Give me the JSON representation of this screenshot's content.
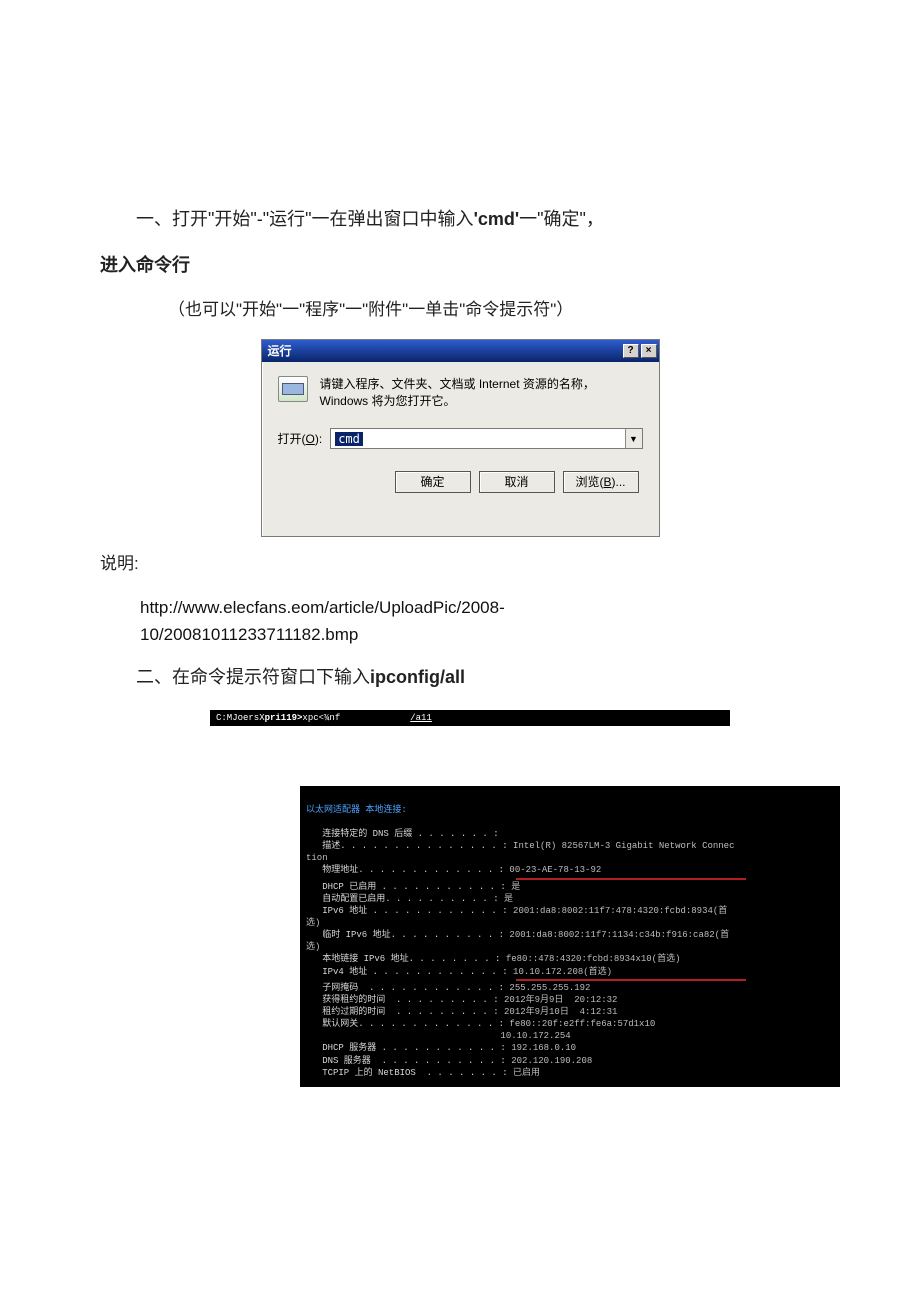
{
  "doc": {
    "p1_prefix": "一、打开\"开始\"-\"运行\"一在弹出窗口中输入",
    "p1_bold1": "'cmd'",
    "p1_suffix": "一\"确定\"，",
    "p2": "进入命令行",
    "p3": "（也可以\"开始\"一\"程序\"一\"附件\"一单击\"命令提示符\"）",
    "note_label": "说明:",
    "url_line1": "http://www.elecfans.eom/article/UploadPic/2008-",
    "url_line2": "10/20081011233711182.bmp",
    "p4_prefix": "二、在命令提示符窗口下输入",
    "p4_bold": "ipconfig/all"
  },
  "run_dialog": {
    "title": "运行",
    "help_btn": "?",
    "close_btn": "×",
    "message": "请键入程序、文件夹、文档或 Internet 资源的名称，Windows 将为您打开它。",
    "open_label_pre": "打开(",
    "open_label_u": "O",
    "open_label_post": "):",
    "input_value": "cmd",
    "dropdown_glyph": "▼",
    "ok": "确定",
    "cancel": "取消",
    "browse_pre": "浏览(",
    "browse_u": "B",
    "browse_post": ")..."
  },
  "cmdbar": {
    "left_a": "C:MJoersX",
    "left_b": "pri119>",
    "mid": "xpc<¾nf",
    "right": "/a11"
  },
  "ipconfig": {
    "header": "以太网适配器 本地连接:",
    "dns_suffix_label": "连接特定的 DNS 后缀 . . . . . . . :",
    "desc_label": "描述. . . . . . . . . . . . . . . :",
    "desc_value": " Intel(R) 82567LM-3 Gigabit Network Connec",
    "desc_wrap": "tion",
    "phys_label": "物理地址. . . . . . . . . . . . . :",
    "phys_value": " 00-23-AE-78-13-92",
    "dhcp_en_label": "DHCP 已启用 . . . . . . . . . . . :",
    "dhcp_en_value": " 是",
    "autoconf_label": "自动配置已启用. . . . . . . . . . :",
    "autoconf_value": " 是",
    "ipv6_label": "IPv6 地址 . . . . . . . . . . . . :",
    "ipv6_value": " 2001:da8:8002:11f7:478:4320:fcbd:8934(首",
    "ipv6_wrap": "选)",
    "temp_ipv6_label": "临时 IPv6 地址. . . . . . . . . . :",
    "temp_ipv6_value": " 2001:da8:8002:11f7:1134:c34b:f916:ca82(首",
    "temp_ipv6_wrap": "选)",
    "linklocal_label": "本地链接 IPv6 地址. . . . . . . . :",
    "linklocal_value": " fe80::478:4320:fcbd:8934x10(首选)",
    "ipv4_label": "IPv4 地址 . . . . . . . . . . . . :",
    "ipv4_value": " 10.10.172.208(首选)",
    "mask_label": "子网掩码  . . . . . . . . . . . . :",
    "mask_value": " 255.255.255.192",
    "lease_obt_label": "获得租约的时间  . . . . . . . . . :",
    "lease_obt_value": " 2012年9月9日  20:12:32",
    "lease_exp_label": "租约过期的时间  . . . . . . . . . :",
    "lease_exp_value": " 2012年9月10日  4:12:31",
    "gw_label": "默认网关. . . . . . . . . . . . . :",
    "gw_value": " fe80::20f:e2ff:fe6a:57d1x10",
    "gw_value2": "                                    10.10.172.254",
    "dhcp_srv_label": "DHCP 服务器 . . . . . . . . . . . :",
    "dhcp_srv_value": " 192.168.0.10",
    "dns_srv_label": "DNS 服务器  . . . . . . . . . . . :",
    "dns_srv_value": " 202.120.190.208",
    "netbios_label": "TCPIP 上的 NetBIOS  . . . . . . . :",
    "netbios_value": " 已启用"
  }
}
